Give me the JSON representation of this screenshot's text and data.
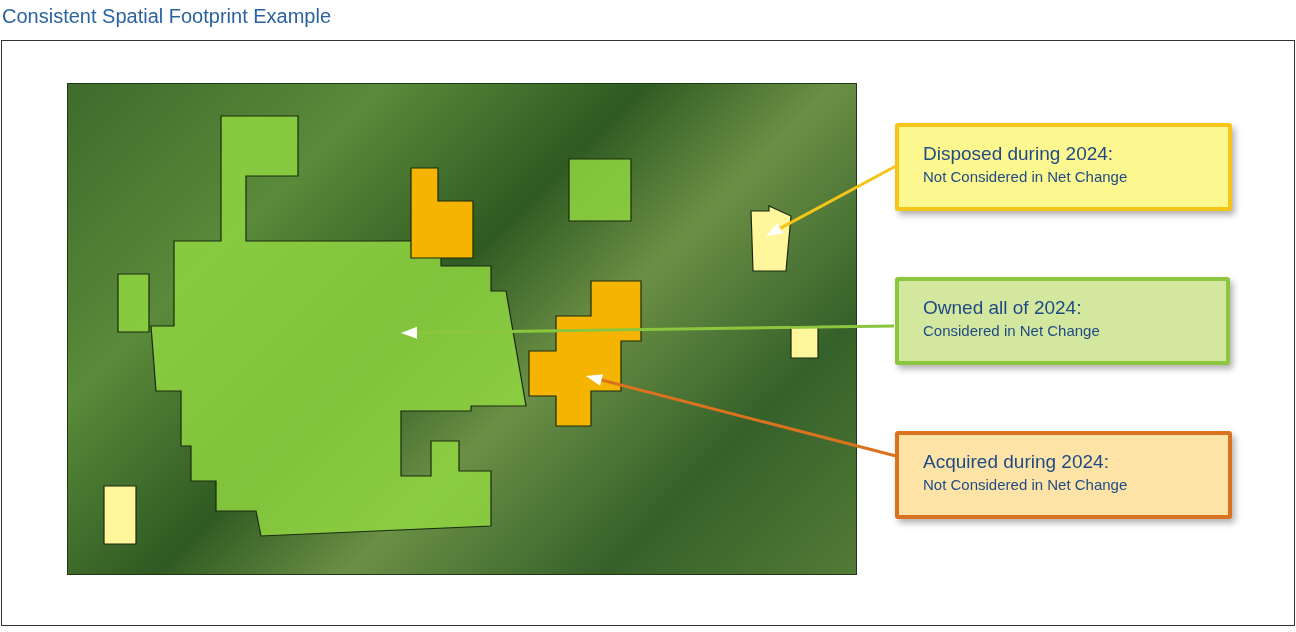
{
  "title": "Consistent Spatial Footprint Example",
  "callouts": [
    {
      "kind": "disposed",
      "title": "Disposed during 2024:",
      "subtitle": "Not Considered in Net Change",
      "color": "#f5c518"
    },
    {
      "kind": "owned",
      "title": "Owned all of 2024:",
      "subtitle": "Considered in Net Change",
      "color": "#8cc63f"
    },
    {
      "kind": "acquired",
      "title": "Acquired during 2024:",
      "subtitle": "Not Considered in Net Change",
      "color": "#d9731f"
    }
  ]
}
